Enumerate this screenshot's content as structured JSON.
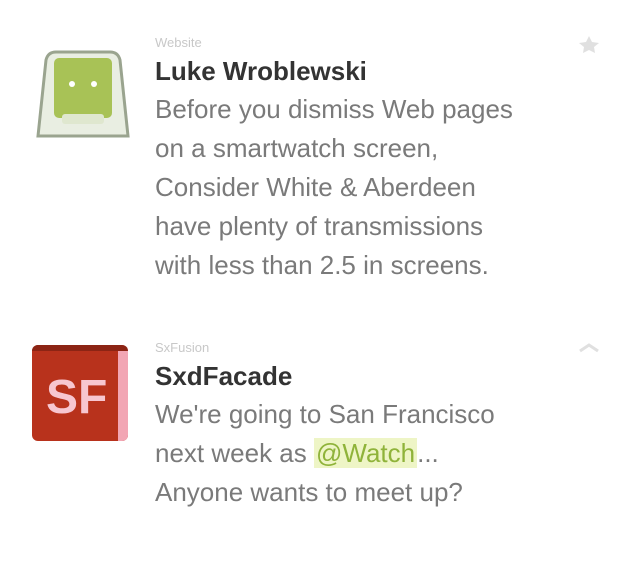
{
  "feed": {
    "items": [
      {
        "source": "Website",
        "title": "Luke Wroblewski",
        "body_lines": [
          "Before you dismiss Web pages",
          "on a smartwatch screen,",
          "Consider White & Aberdeen",
          "have plenty of transmissions",
          "with less than 2.5 in screens."
        ],
        "avatar_icon": "android-icon",
        "avatar_color": "#a8c256",
        "action_icon": "star-icon"
      },
      {
        "source": "SxFusion",
        "title": "SxdFacade",
        "body_lines_before": [
          "We're going to San Francisco",
          "next week as "
        ],
        "highlight": "@Watch",
        "body_after_highlight": "...",
        "body_lines_after": [
          "Anyone wants to meet up?"
        ],
        "avatar_icon": "sf-logo-icon",
        "avatar_text": "SF",
        "avatar_color": "#b8321c",
        "action_icon": "chevron-icon"
      }
    ]
  }
}
